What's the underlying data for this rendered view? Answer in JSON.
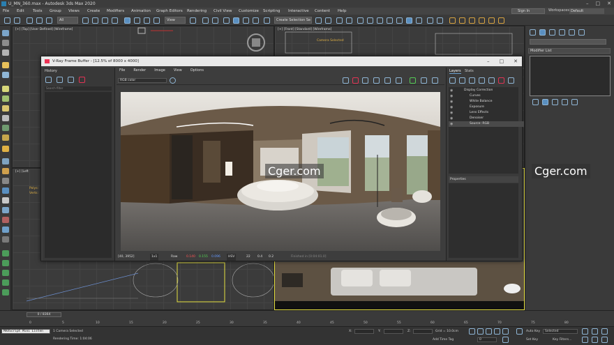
{
  "window": {
    "title": "U_MN_360.max - Autodesk 3ds Max 2020"
  },
  "menu": [
    "File",
    "Edit",
    "Tools",
    "Group",
    "Views",
    "Create",
    "Modifiers",
    "Animation",
    "Graph Editors",
    "Rendering",
    "Civil View",
    "Customize",
    "Scripting",
    "Interactive",
    "Content",
    "Help"
  ],
  "signin": "Sign In",
  "workspaces": {
    "label": "Workspaces:",
    "value": "Default"
  },
  "toolbar": {
    "filter": "All",
    "view": "View",
    "selection_set": "Create Selection Se"
  },
  "viewports": {
    "top_left": "[+] [Top] [User Defined] [Wireframe]",
    "top_right": "[+] [Front] [Standard] [Wireframe]",
    "left_label": "[+] [Left",
    "overlay_lines": [
      "Polys:",
      "Verts:"
    ],
    "front_overlay": [
      "Camera Selected"
    ]
  },
  "command_panel": {
    "modifier_list": "Modifier List"
  },
  "vfb": {
    "title": "V-Ray Frame Buffer - [12.5% of 8000 x 4000]",
    "history_title": "History",
    "history_search": "Search filter",
    "menu": [
      "File",
      "Render",
      "Image",
      "View",
      "Options"
    ],
    "channel": "RGB color",
    "tabs": [
      "Layers",
      "Stats"
    ],
    "layers": [
      "Display Correction",
      "Curves",
      "White Balance",
      "Exposure",
      "Lens Effects",
      "Denoiser",
      "Source: RGB"
    ],
    "properties": "Properties",
    "status": {
      "coords": "[40, 3952]",
      "zoom": "1x1",
      "mode": "Raw",
      "r": "0.140",
      "g": "0.155",
      "b": "0.096",
      "space": "HSV",
      "h": "22",
      "s": "0.4",
      "v": "0.2",
      "finished": "Finished in [0:04:01.0]"
    }
  },
  "watermark": "Cger.com",
  "timeline": {
    "frame": "0 / 8364",
    "ticks": [
      "0",
      "5",
      "10",
      "15",
      "20",
      "25",
      "30",
      "35",
      "40",
      "45",
      "50",
      "55",
      "60",
      "65",
      "70",
      "75",
      "80",
      "85",
      "90",
      "95",
      "100"
    ]
  },
  "status": {
    "selected": "1 Camera Selected",
    "render_time": "Rendering Time: 1:04:06",
    "maxscript": "MAXScript Mini Listen",
    "x_label": "X:",
    "y_label": "Y:",
    "z_label": "Z:",
    "grid": "Grid = 10.0cm",
    "add_tag": "Add Time Tag",
    "frame_field": "0",
    "auto_key": "Auto Key",
    "set_key": "Set Key",
    "selected_drop": "Selected",
    "key_filters": "Key Filters..."
  },
  "colors": {
    "accent_blue": "#8fb6d6",
    "vray_red": "#e33355",
    "status_red": "#ff5555",
    "status_green": "#55dd55",
    "status_blue": "#6699ff"
  }
}
